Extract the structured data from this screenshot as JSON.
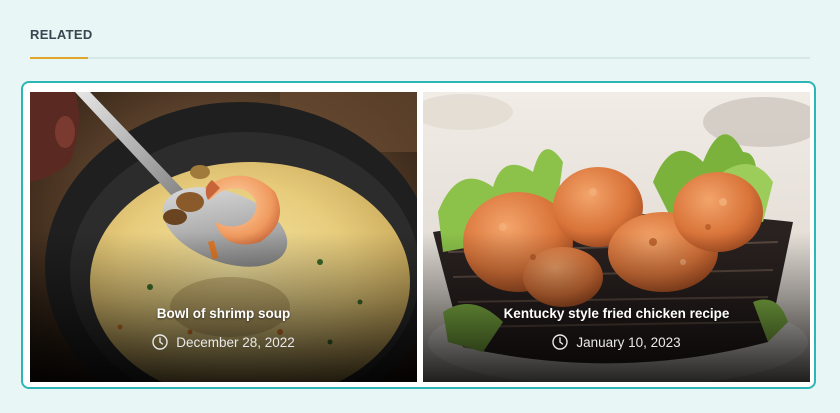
{
  "section": {
    "title": "RELATED"
  },
  "colors": {
    "background": "#e8f6f6",
    "accent": "#e0a52a",
    "border": "#2eb5b5"
  },
  "posts": [
    {
      "title": "Bowl of shrimp soup",
      "date": "December 28, 2022",
      "icon": "clock-icon"
    },
    {
      "title": "Kentucky style fried chicken recipe",
      "date": "January 10, 2023",
      "icon": "clock-icon"
    }
  ]
}
